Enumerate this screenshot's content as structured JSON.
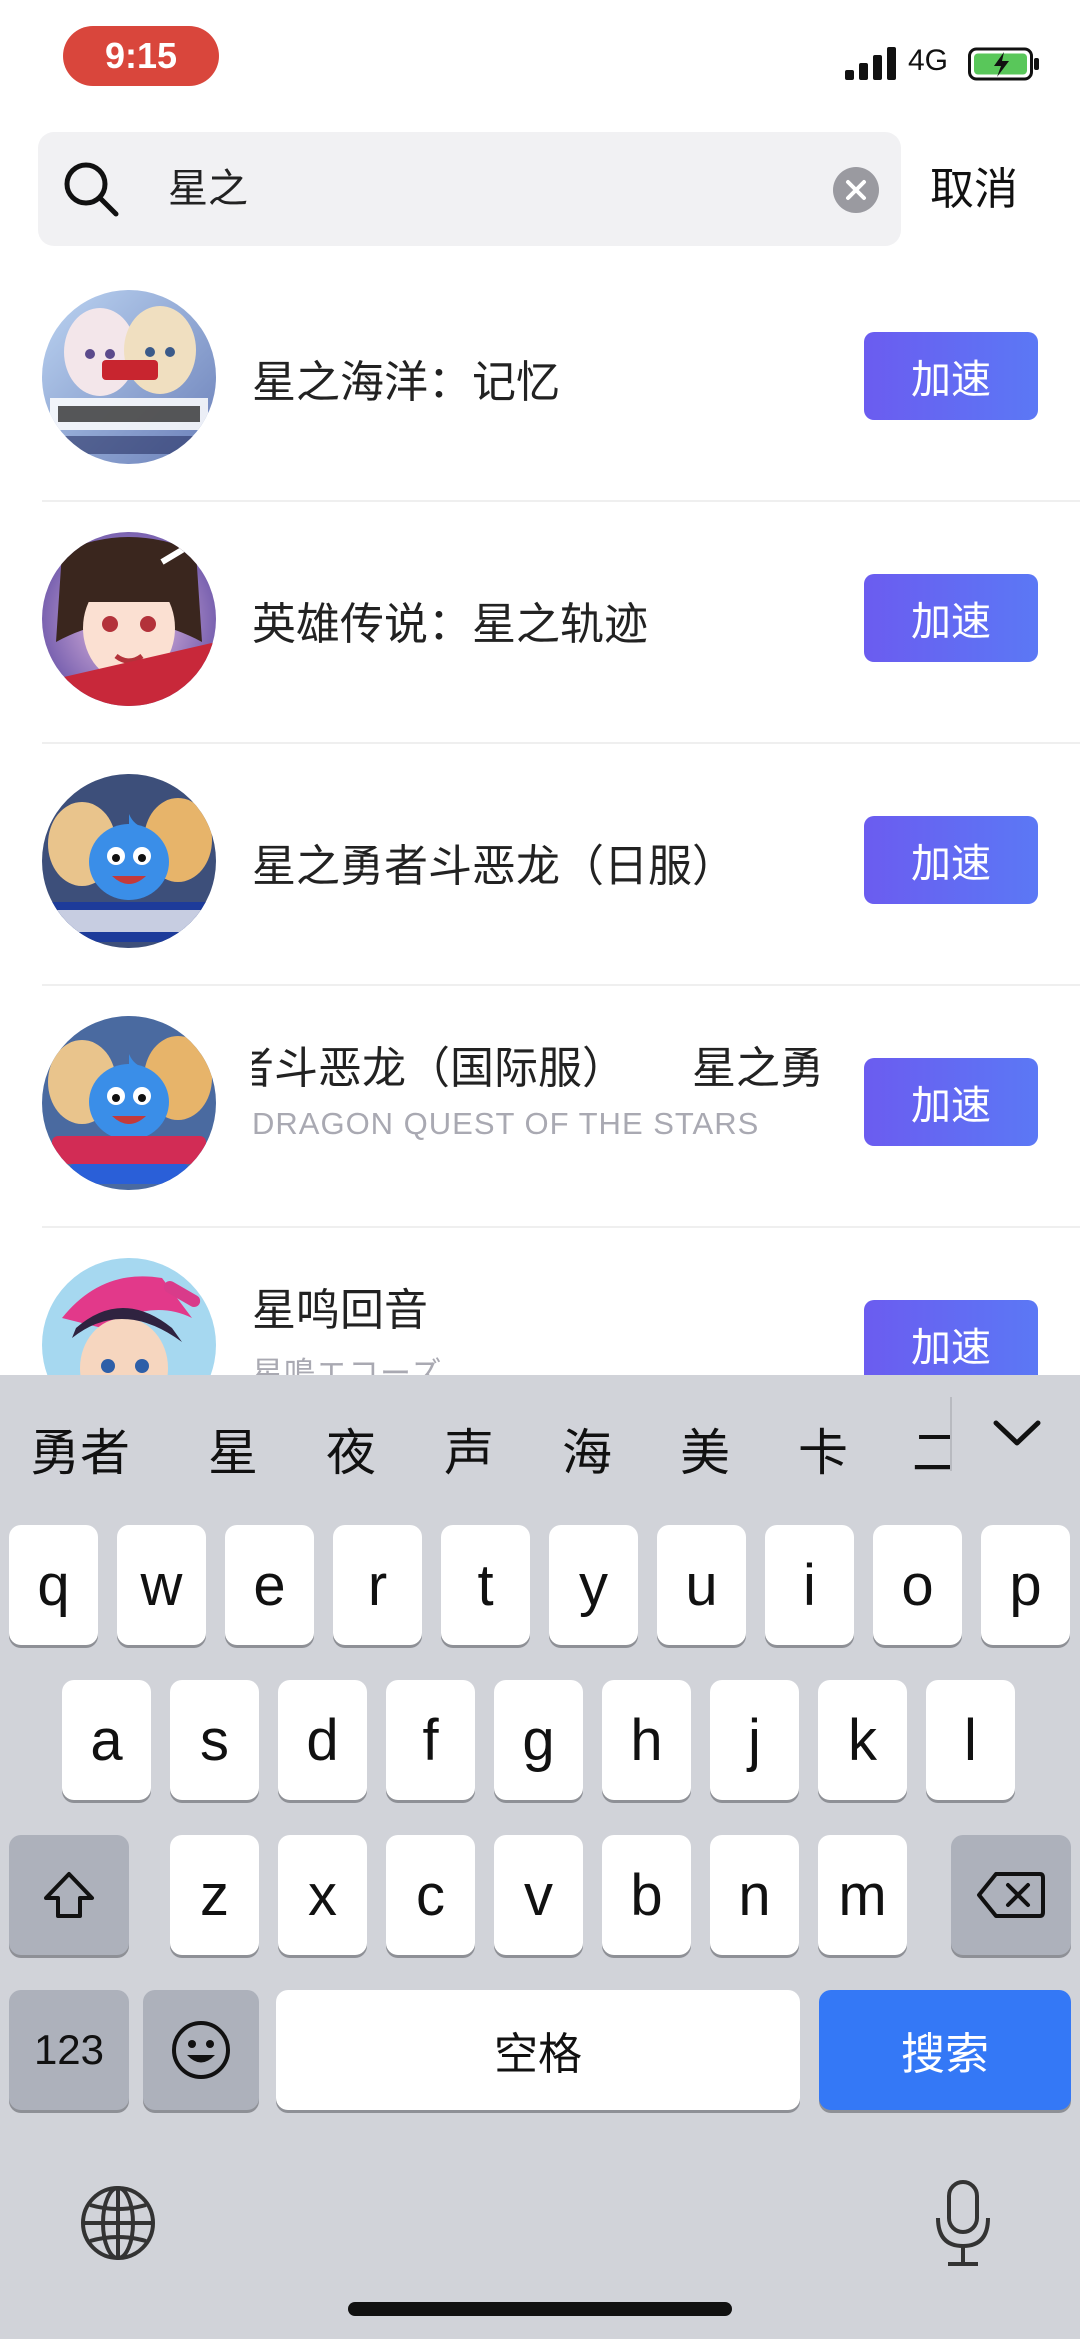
{
  "status_bar": {
    "time": "9:15",
    "network": "4G"
  },
  "search": {
    "query": "星之",
    "cancel_label": "取消"
  },
  "results": [
    {
      "title": "星之海洋：记忆",
      "subtitle": "",
      "button": "加速"
    },
    {
      "title": "英雄传说：星之轨迹",
      "subtitle": "",
      "button": "加速"
    },
    {
      "title": "星之勇者斗恶龙（日服）",
      "subtitle": "",
      "button": "加速"
    },
    {
      "title": "者斗恶龙（国际服）　　星之勇",
      "subtitle": "DRAGON QUEST OF THE STARS",
      "button": "加速"
    },
    {
      "title": "星鸣回音",
      "subtitle": "星鳴エコーズ",
      "button": "加速"
    }
  ],
  "keyboard": {
    "candidates": [
      "勇者",
      "星",
      "夜",
      "声",
      "海",
      "美",
      "卡",
      "二"
    ],
    "row1": [
      "q",
      "w",
      "e",
      "r",
      "t",
      "y",
      "u",
      "i",
      "o",
      "p"
    ],
    "row2": [
      "a",
      "s",
      "d",
      "f",
      "g",
      "h",
      "j",
      "k",
      "l"
    ],
    "row3": [
      "z",
      "x",
      "c",
      "v",
      "b",
      "n",
      "m"
    ],
    "numbers_label": "123",
    "space_label": "空格",
    "search_label": "搜索"
  },
  "colors": {
    "accent": "#5b6cf2",
    "time_pill": "#d9463c",
    "search_key": "#3478f6"
  },
  "icons": [
    "search-icon",
    "clear-icon",
    "shift-icon",
    "backspace-icon",
    "emoji-icon",
    "globe-icon",
    "mic-icon",
    "chevron-down-icon"
  ]
}
